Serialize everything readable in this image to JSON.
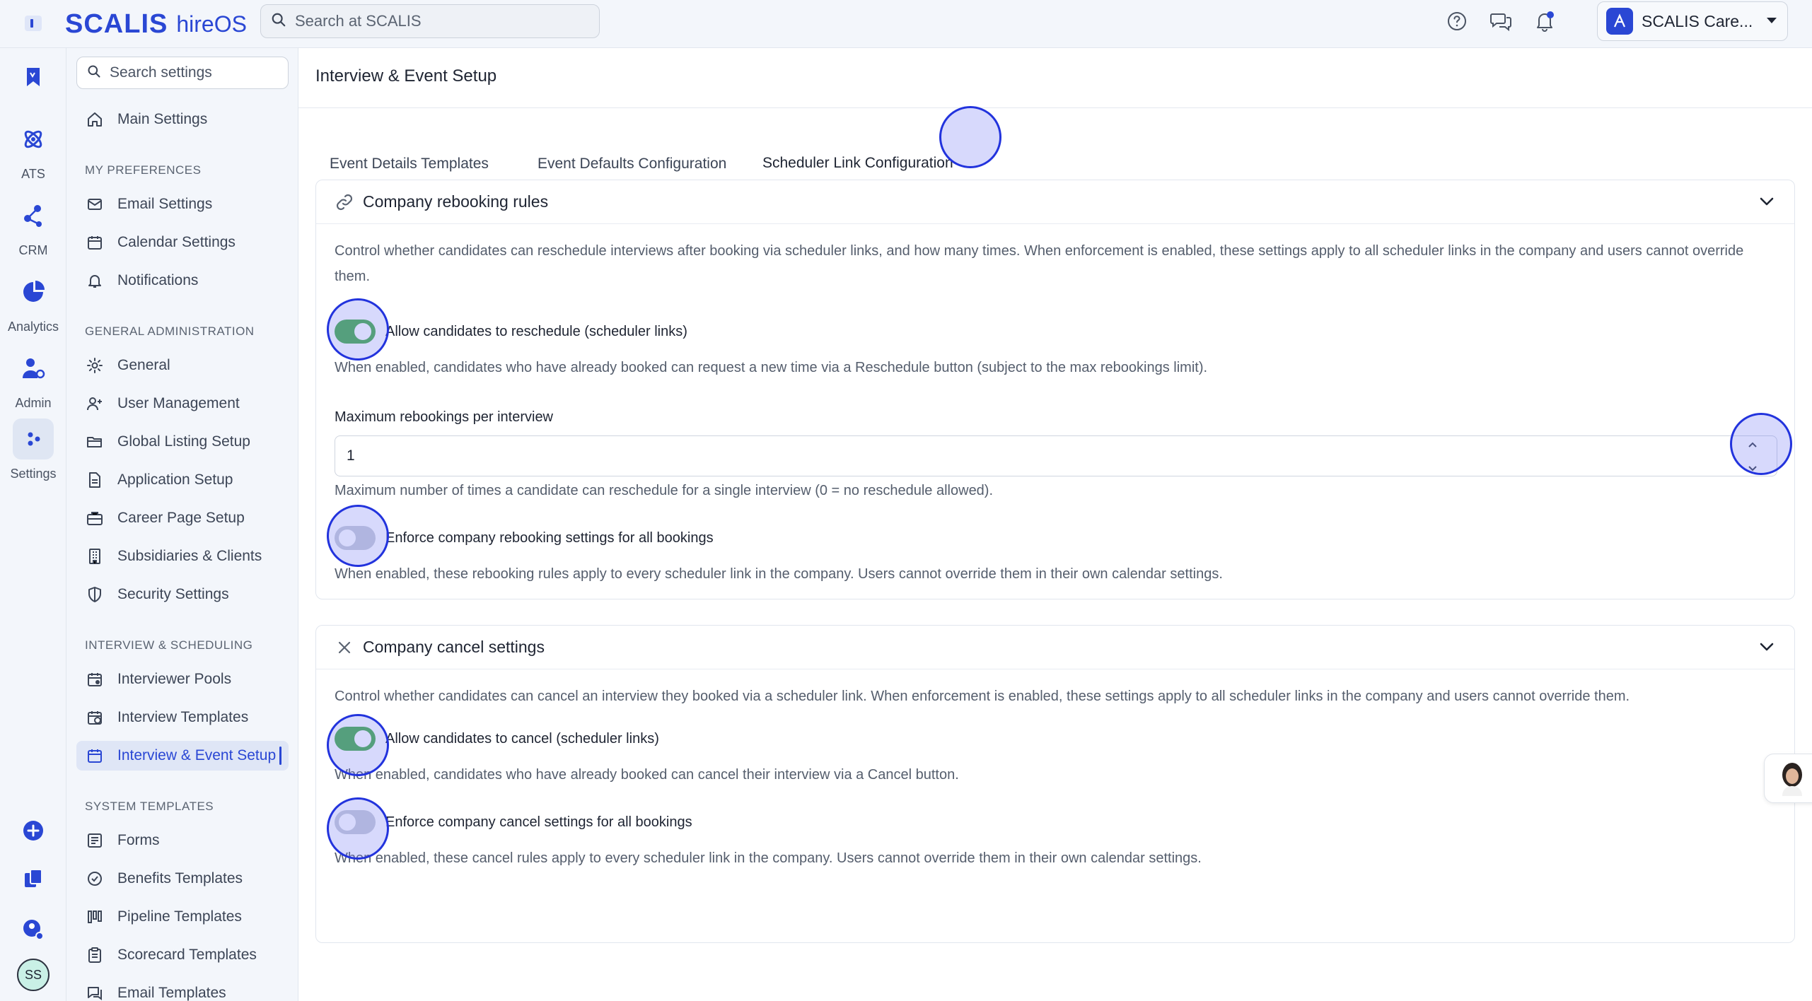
{
  "app": {
    "brand_main": "SCALIS",
    "brand_sub": "hireOS",
    "search_placeholder": "Search at SCALIS",
    "company_name": "SCALIS Care..."
  },
  "rail": [
    {
      "label": "",
      "icon": "bookmark-icon"
    },
    {
      "label": "ATS",
      "icon": "atom-icon"
    },
    {
      "label": "CRM",
      "icon": "network-icon"
    },
    {
      "label": "Analytics",
      "icon": "pie-chart-icon"
    },
    {
      "label": "Admin",
      "icon": "admin-user-icon"
    },
    {
      "label": "Settings",
      "icon": "settings-dots-icon"
    }
  ],
  "rail_bottom": {
    "avatar_initials": "SS"
  },
  "sidebar": {
    "search_placeholder": "Search settings",
    "main_settings": "Main Settings",
    "sections": [
      {
        "heading": "MY PREFERENCES",
        "items": [
          "Email Settings",
          "Calendar Settings",
          "Notifications"
        ]
      },
      {
        "heading": "GENERAL ADMINISTRATION",
        "items": [
          "General",
          "User Management",
          "Global Listing Setup",
          "Application Setup",
          "Career Page Setup",
          "Subsidiaries & Clients",
          "Security Settings"
        ]
      },
      {
        "heading": "INTERVIEW & SCHEDULING",
        "items": [
          "Interviewer Pools",
          "Interview Templates",
          "Interview & Event Setup"
        ]
      },
      {
        "heading": "SYSTEM TEMPLATES",
        "items": [
          "Forms",
          "Benefits Templates",
          "Pipeline Templates",
          "Scorecard Templates",
          "Email Templates"
        ]
      }
    ],
    "active_item": "Interview & Event Setup"
  },
  "main": {
    "title": "Interview & Event Setup",
    "tabs": [
      "Event Details Templates",
      "Event Defaults Configuration",
      "Scheduler Link Configuration"
    ],
    "active_tab": "Scheduler Link Configuration",
    "rebooking": {
      "title": "Company rebooking rules",
      "description": "Control whether candidates can reschedule interviews after booking via scheduler links, and how many times. When enforcement is enabled, these settings apply to all scheduler links in the company and users cannot override them.",
      "allow_label": "Allow candidates to reschedule (scheduler links)",
      "allow_on": true,
      "allow_help": "When enabled, candidates who have already booked can request a new time via a Reschedule button (subject to the max rebookings limit).",
      "max_label": "Maximum rebookings per interview",
      "max_value": "1",
      "max_help": "Maximum number of times a candidate can reschedule for a single interview (0 = no reschedule allowed).",
      "enforce_label": "Enforce company rebooking settings for all bookings",
      "enforce_on": false,
      "enforce_help": "When enabled, these rebooking rules apply to every scheduler link in the company. Users cannot override them in their own calendar settings."
    },
    "cancel": {
      "title": "Company cancel settings",
      "description": "Control whether candidates can cancel an interview they booked via a scheduler link. When enforcement is enabled, these settings apply to all scheduler links in the company and users cannot override them.",
      "allow_label": "Allow candidates to cancel (scheduler links)",
      "allow_on": true,
      "allow_help": "When enabled, candidates who have already booked can cancel their interview via a Cancel button.",
      "enforce_label": "Enforce company cancel settings for all bookings",
      "enforce_on": false,
      "enforce_help": "When enabled, these cancel rules apply to every scheduler link in the company. Users cannot override them in their own calendar settings."
    }
  },
  "colors": {
    "brand": "#2a47d4",
    "toggle_on": "#4caf50",
    "toggle_off": "#c9ced8",
    "highlight": "#2233dd"
  }
}
